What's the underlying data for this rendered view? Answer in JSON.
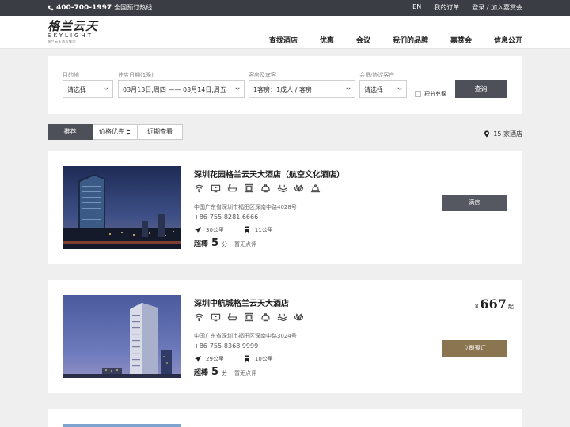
{
  "topbar": {
    "hotline_number": "400-700-1997",
    "hotline_label": "全国预订热线",
    "lang": "EN",
    "my_orders": "我的订单",
    "login": "登录 / 加入嘉赏会"
  },
  "brand": {
    "cn": "格兰云天",
    "en": "SKYLIGHT",
    "sub": "格兰云天酒店集团"
  },
  "nav": [
    "查找酒店",
    "优惠",
    "会议",
    "我们的品牌",
    "嘉赏会",
    "信息公开"
  ],
  "search": {
    "destination_label": "目的地",
    "destination_value": "请选择",
    "dates_label": "住店日期(1晚)",
    "dates_value": "03月13日,周四 —— 03月14日,周五",
    "rooms_label": "客房及宾客",
    "rooms_value": "1客房：1成人 / 客房",
    "member_label": "会员/协议客户",
    "member_value": "请选择",
    "points_label": "积分兑换",
    "submit": "查询"
  },
  "sort_tabs": [
    "推荐",
    "价格优先",
    "近期查看"
  ],
  "hotel_count": "15 家酒店",
  "hotels": [
    {
      "name": "深圳花园格兰云天大酒店（航空文化酒店）",
      "address": "中国广东省深圳市福田区深南中路4028号",
      "phone": "+86-755-8281 6666",
      "airport_distance": "30公里",
      "metro_distance": "11公里",
      "rating_word": "超棒",
      "rating_score": "5",
      "rating_unit": "分",
      "reviews": "暂无点评",
      "action": "满房",
      "amenities": [
        "wifi-icon",
        "tv-icon",
        "bathtub-icon",
        "safe-icon",
        "kettle-icon",
        "pool-icon",
        "spa-icon",
        "restaurant-icon"
      ]
    },
    {
      "name": "深圳中航城格兰云天大酒店",
      "address": "中国广东省深圳市福田区深南中路3024号",
      "phone": "+86-755-8368 9999",
      "airport_distance": "29公里",
      "metro_distance": "10公里",
      "rating_word": "超棒",
      "rating_score": "5",
      "rating_unit": "分",
      "reviews": "暂无点评",
      "price_currency": "¥",
      "price": "667",
      "price_suffix": "起",
      "action": "立即预订",
      "amenities": [
        "wifi-icon",
        "tv-icon",
        "bathtub-icon",
        "safe-icon",
        "kettle-icon",
        "pool-icon",
        "spa-icon"
      ]
    }
  ],
  "colors": {
    "topbar": "#3a3d44",
    "primary_button": "#4d5058",
    "book_button": "#8b7550",
    "page_bg": "#efefef"
  }
}
